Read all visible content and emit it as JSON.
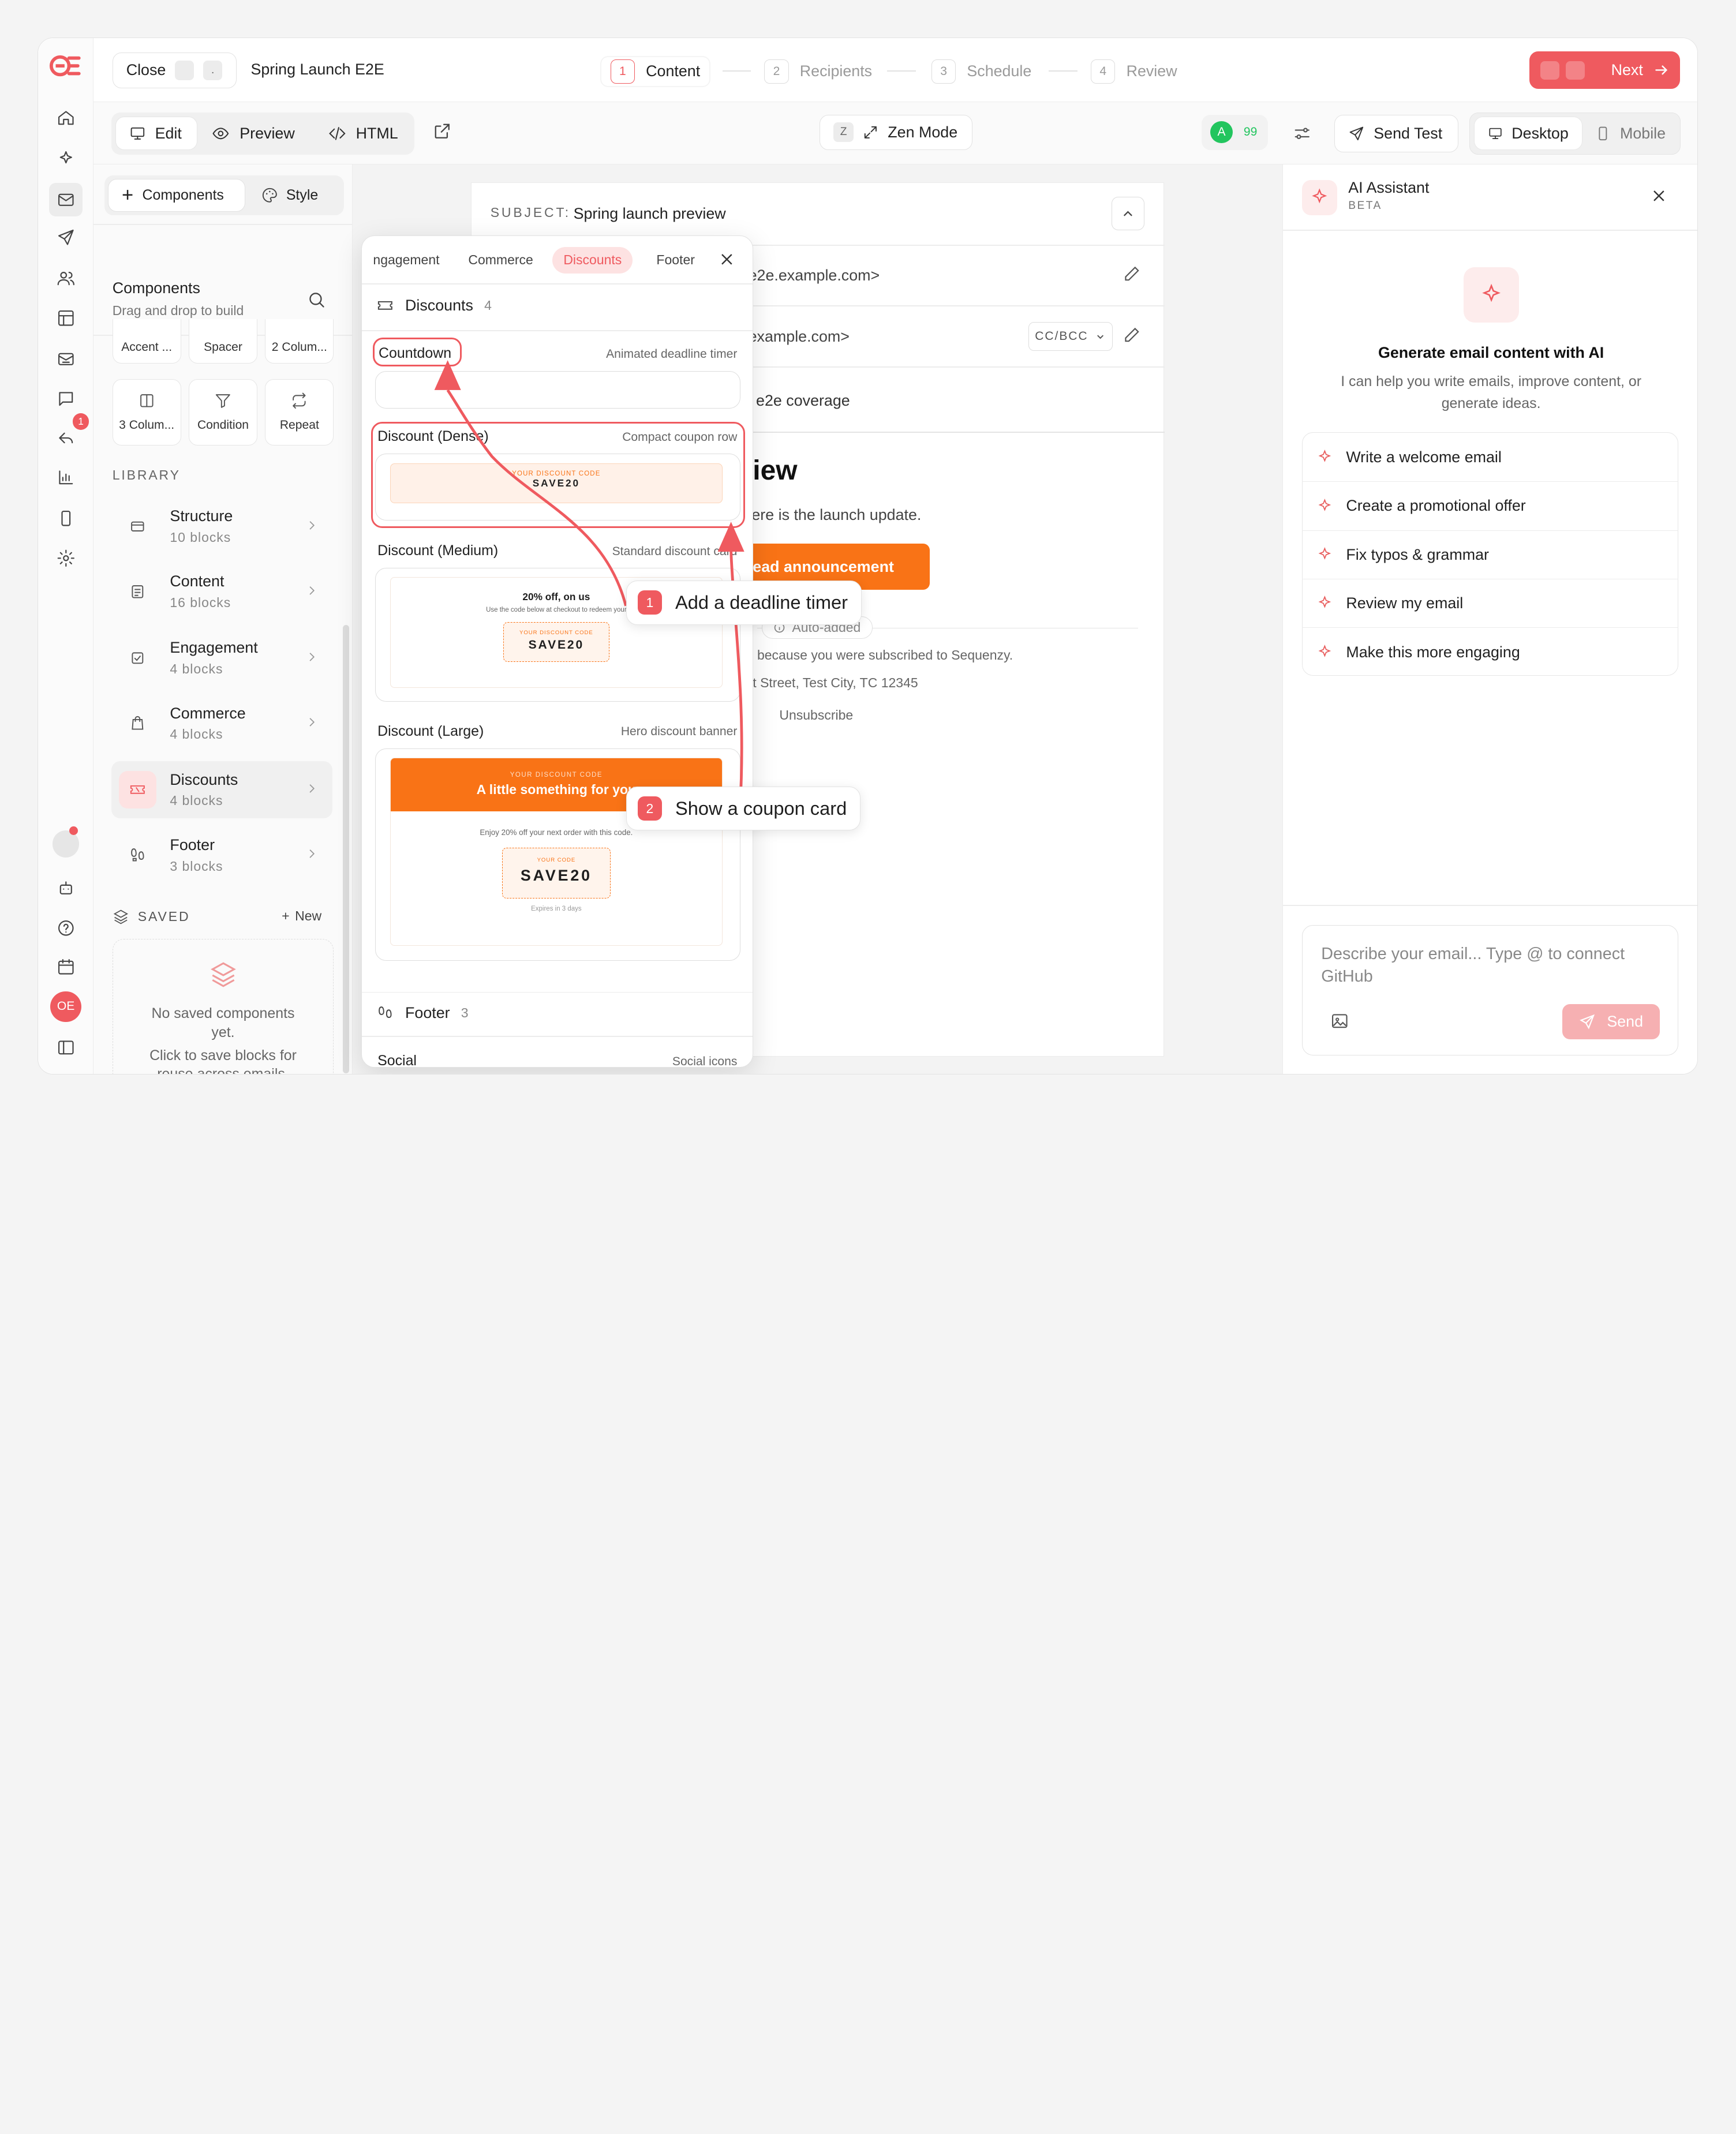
{
  "app": {
    "logo": "OE"
  },
  "topbar": {
    "close_label": "Close",
    "kbd_close": ".",
    "campaign_name": "Spring Launch E2E",
    "next_label": "Next",
    "steps": [
      {
        "n": "1",
        "label": "Content"
      },
      {
        "n": "2",
        "label": "Recipients"
      },
      {
        "n": "3",
        "label": "Schedule"
      },
      {
        "n": "4",
        "label": "Review"
      }
    ]
  },
  "toolbar": {
    "edit": "Edit",
    "preview": "Preview",
    "html": "HTML",
    "zen_kbd": "Z",
    "zen": "Zen Mode",
    "score_badge": "A",
    "score": "99",
    "send_test": "Send Test",
    "desktop": "Desktop",
    "mobile": "Mobile"
  },
  "rail": {
    "notif_count": "1",
    "avatar": "OE"
  },
  "sidebar": {
    "tab_components": "Components",
    "tab_style": "Style",
    "title": "Components",
    "subtitle": "Drag and drop to build",
    "row_partial": [
      "Accent ...",
      "Spacer",
      "2 Colum..."
    ],
    "tiles": [
      "3 Colum...",
      "Condition",
      "Repeat"
    ],
    "library_label": "LIBRARY",
    "categories": [
      {
        "name": "Structure",
        "count": "10 blocks"
      },
      {
        "name": "Content",
        "count": "16 blocks"
      },
      {
        "name": "Engagement",
        "count": "4 blocks"
      },
      {
        "name": "Commerce",
        "count": "4 blocks"
      },
      {
        "name": "Discounts",
        "count": "4 blocks"
      },
      {
        "name": "Footer",
        "count": "3 blocks"
      }
    ],
    "saved_label": "SAVED",
    "new_label": "New",
    "empty_line1": "No saved components yet.",
    "empty_line2": "Click to save blocks for reuse across emails."
  },
  "email": {
    "subject_label": "SUBJECT:",
    "subject": "Spring launch preview",
    "from_partial": "e2e.example.com>",
    "to_partial": "example.com>",
    "cc_bcc": "CC/BCC",
    "preheader_partial": "e2e coverage",
    "heading_partial": "iew",
    "body_partial": "ere is the launch update.",
    "cta_partial": "ead announcement",
    "auto_added": "Auto-added",
    "footer1": "because you were subscribed to Sequenzy.",
    "footer2": "t Street, Test City, TC 12345",
    "unsubscribe": "Unsubscribe"
  },
  "popup": {
    "tabs": [
      "ngagement",
      "Commerce",
      "Discounts",
      "Footer"
    ],
    "section": "Discounts",
    "section_count": "4",
    "blocks": [
      {
        "name": "Countdown",
        "desc": "Animated deadline timer"
      },
      {
        "name": "Discount (Dense)",
        "desc": "Compact coupon row"
      },
      {
        "name": "Discount (Medium)",
        "desc": "Standard discount card"
      },
      {
        "name": "Discount (Large)",
        "desc": "Hero discount banner"
      }
    ],
    "dense_code_label": "YOUR DISCOUNT CODE",
    "dense_code": "SAVE20",
    "medium_title": "20% off, on us",
    "medium_text": "Use the code below at checkout to redeem your",
    "medium_code_label": "YOUR DISCOUNT CODE",
    "medium_code": "SAVE20",
    "large_label": "YOUR DISCOUNT CODE",
    "large_title": "A little something for you",
    "large_text": "Enjoy 20% off your next order with this code.",
    "large_code_label": "YOUR CODE",
    "large_code": "SAVE20",
    "large_expires": "Expires in 3 days",
    "footer_section": "Footer",
    "footer_count": "3",
    "social": "Social",
    "social_desc": "Social icons"
  },
  "callouts": [
    {
      "n": "1",
      "text": "Add a deadline timer"
    },
    {
      "n": "2",
      "text": "Show a coupon card"
    }
  ],
  "ai": {
    "title": "AI Assistant",
    "beta": "BETA",
    "heading": "Generate email content with AI",
    "desc": "I can help you write emails, improve content, or generate ideas.",
    "suggestions": [
      "Write a welcome email",
      "Create a promotional offer",
      "Fix typos & grammar",
      "Review my email",
      "Make this more engaging"
    ],
    "input_placeholder": "Describe your email... Type @ to connect GitHub",
    "send": "Send"
  },
  "colors": {
    "accent": "#ef5a5f",
    "orange": "#f97316",
    "success": "#22c55e"
  }
}
